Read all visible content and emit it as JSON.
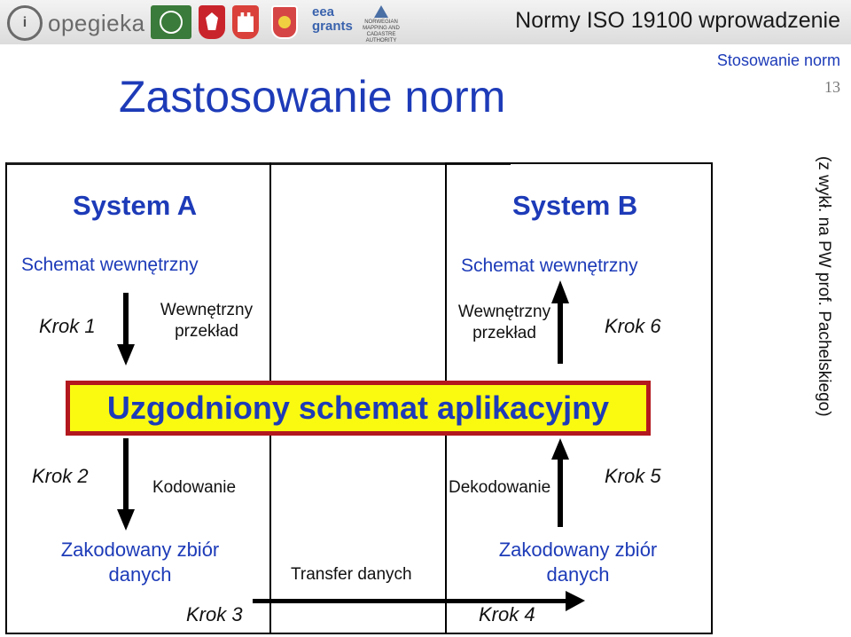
{
  "header": {
    "logo_text": "opegieka",
    "logo_mark": "i",
    "eea_line1": "eea",
    "eea_line2": "grants",
    "nma_text": "NORWEGIAN MAPPING AND CADASTRE AUTHORITY",
    "title": "Normy ISO 19100 wprowadzenie"
  },
  "section_label": "Stosowanie norm",
  "page_number": "13",
  "slide_title": "Zastosowanie norm",
  "diagram": {
    "system_a": {
      "title": "System A",
      "schema_label": "Schemat wewnętrzny",
      "internal_translation": [
        "Wewnętrzny",
        "przekład"
      ],
      "encoding": "Kodowanie",
      "dataset": [
        "Zakodowany zbiór",
        "danych"
      ]
    },
    "system_b": {
      "title": "System B",
      "schema_label": "Schemat wewnętrzny",
      "internal_translation": [
        "Wewnętrzny",
        "przekład"
      ],
      "decoding": "Dekodowanie",
      "dataset": [
        "Zakodowany zbiór",
        "danych"
      ]
    },
    "banner": "Uzgodniony schemat aplikacyjny",
    "transfer": "Transfer danych",
    "steps": {
      "krok1": "Krok 1",
      "krok2": "Krok 2",
      "krok3": "Krok 3",
      "krok4": "Krok 4",
      "krok5": "Krok 5",
      "krok6": "Krok 6"
    },
    "source_credit": "(z wykł. na PW  prof. Pachelskiego)"
  },
  "colors": {
    "accent_blue": "#1d3bb8",
    "banner_fill": "#fafa10",
    "banner_border": "#b3181f"
  }
}
